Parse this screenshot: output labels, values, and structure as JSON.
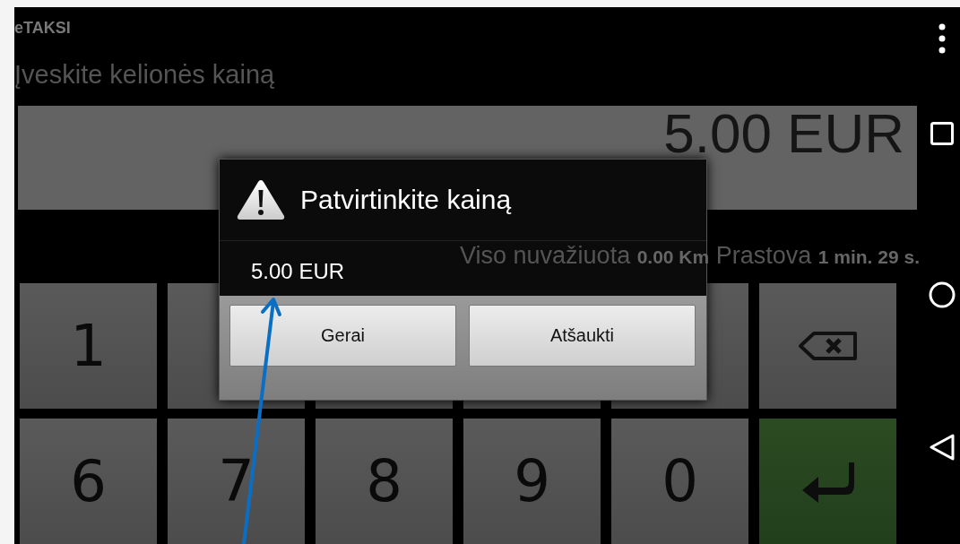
{
  "app_bar": {
    "title": "eTAKSI"
  },
  "heading": "Įveskite kelionės kainą",
  "amount_field": {
    "value": "5.00 EUR"
  },
  "trip_info": "Viso nuvažiuota **0.00 Km** Prastova **1 min. 29 s.**",
  "keypad": {
    "rows": [
      [
        {
          "kind": "digit",
          "label": "1"
        },
        {
          "kind": "blank"
        },
        {
          "kind": "blank"
        },
        {
          "kind": "blank"
        },
        {
          "kind": "blank"
        },
        {
          "kind": "backspace"
        }
      ],
      [
        {
          "kind": "digit",
          "label": "6"
        },
        {
          "kind": "digit",
          "label": "7"
        },
        {
          "kind": "digit",
          "label": "8"
        },
        {
          "kind": "digit",
          "label": "9"
        },
        {
          "kind": "digit",
          "label": "0"
        },
        {
          "kind": "enter"
        }
      ]
    ]
  },
  "dialog": {
    "title": "Patvirtinkite kainą",
    "message": "5.00 EUR",
    "buttons": [
      "Gerai",
      "Atšaukti"
    ]
  }
}
